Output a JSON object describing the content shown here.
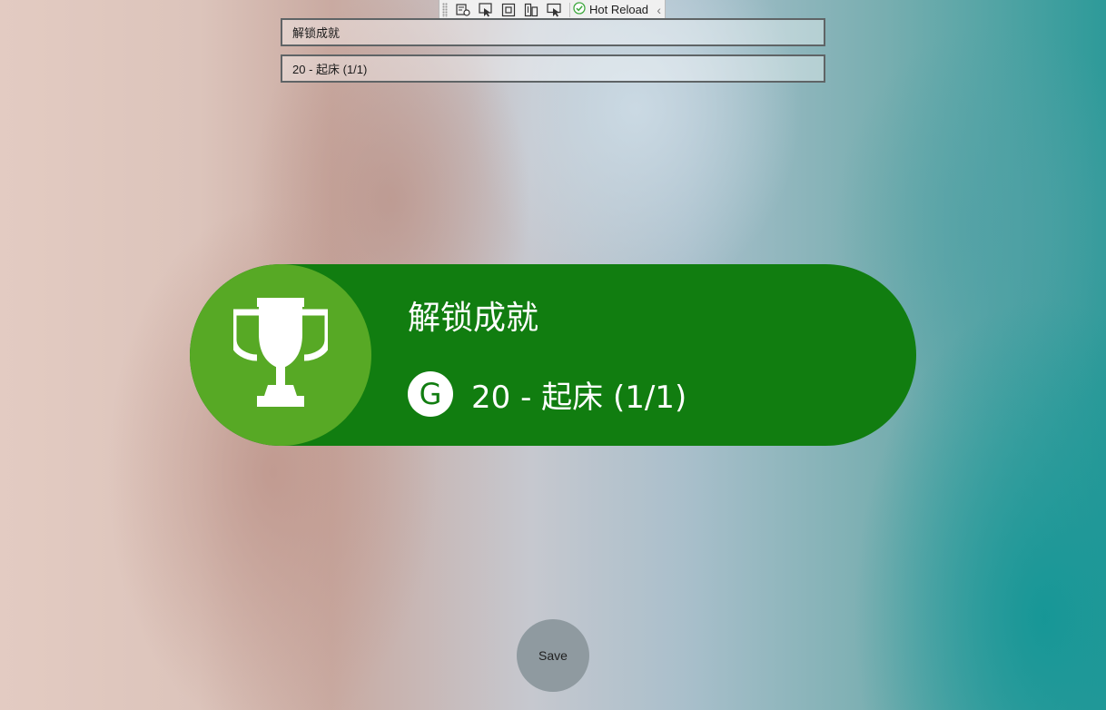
{
  "debug_toolbar": {
    "tools": [
      "live-visual-tree-icon",
      "select-element-icon",
      "display-layout-adorners-icon",
      "track-focus-icon",
      "preview-selection-icon"
    ],
    "hot_reload_label": "Hot Reload",
    "hot_reload_status_color": "#3fa83f"
  },
  "inputs": {
    "title_value": "解锁成就",
    "name_value": "20 - 起床 (1/1)"
  },
  "toast": {
    "title": "解锁成就",
    "gamerscore_icon_letter": "G",
    "achievement_text": "20 - 起床 (1/1)",
    "background_color": "#117d10",
    "trophy_circle_color": "#57a925",
    "icon": "trophy-icon"
  },
  "save_button": {
    "label": "Save"
  }
}
